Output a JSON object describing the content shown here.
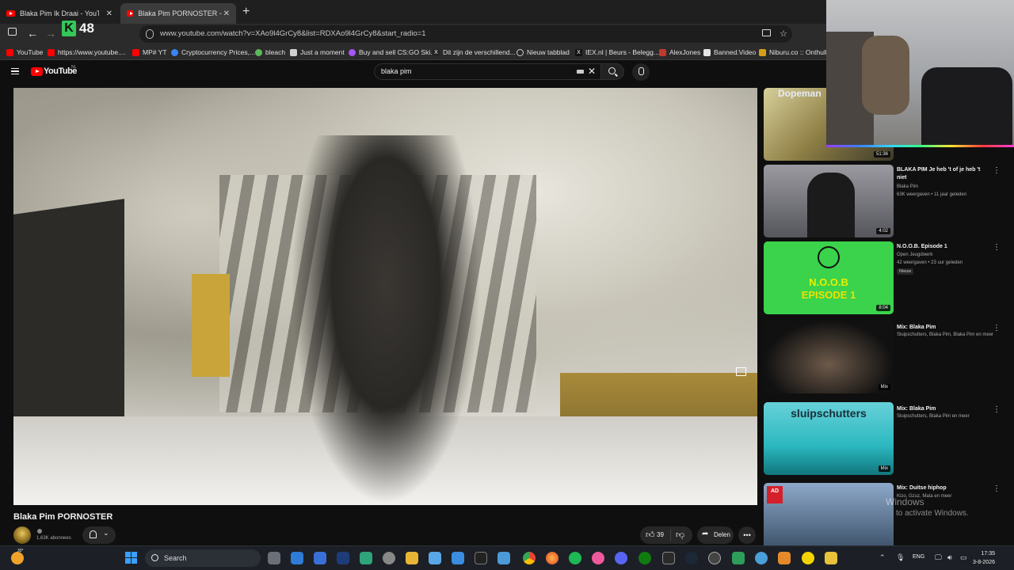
{
  "browser": {
    "tabs": [
      {
        "title": "Blaka Pim Ik Draai - YouTube",
        "active": false
      },
      {
        "title": "Blaka Pim PORNOSTER - YouTube",
        "active": true
      }
    ],
    "new_tab_glyph": "+",
    "close_glyph": "✕",
    "url": "www.youtube.com/watch?v=XAo9l4GrCy8&list=RDXAo9l4GrCy8&start_radio=1",
    "counter_logo": "K",
    "counter_value": "48",
    "bookmarks": [
      {
        "label": "YouTube",
        "color": "#ff0000"
      },
      {
        "label": "https://www.youtube....",
        "color": "#ff0000"
      },
      {
        "label": "MP# YT",
        "color": "#ff0000"
      },
      {
        "label": "Cryptocurrency Prices,...",
        "color": "#3b82f6"
      },
      {
        "label": "bleach",
        "color": "#5cb85c"
      },
      {
        "label": "Just a moment",
        "color": "#d0d0d0"
      },
      {
        "label": "Buy and sell CS:GO Ski...",
        "color": "#a855f7"
      },
      {
        "label": "Dit zijn de verschillend...",
        "color": "#222222"
      },
      {
        "label": "Nieuw tabblad",
        "color": "#9ca3af"
      },
      {
        "label": "IEX.nl | Beurs - Belegg...",
        "color": "#111111"
      },
      {
        "label": "AlexJones",
        "color": "#c0392b"
      },
      {
        "label": "Banned.Video",
        "color": "#e5e5e5"
      },
      {
        "label": "Niburu.co :: Onthulle",
        "color": "#d4a017"
      }
    ]
  },
  "youtube": {
    "logo_text": "YouTube",
    "country": "NL",
    "search_value": "blaka pim",
    "video": {
      "title": "Blaka Pim PORNOSTER",
      "subscribers": "1,63K abonnees",
      "likes": "39",
      "share_label": "Delen",
      "more_glyph": "•••"
    },
    "recommendations": [
      {
        "thumb_text": "Dopeman",
        "duration": "51:36",
        "title": "",
        "channel": "",
        "meta": ""
      },
      {
        "duration": "4:02",
        "title": "BLAKA PIM Je heb 't of je heb 't niet",
        "channel": "Blaka Pim",
        "meta": "63K weergaven • 11 jaar geleden"
      },
      {
        "thumb_text": "N.O.O.B",
        "thumb_text2": "EPISODE 1",
        "duration": "8:04",
        "title": "N.O.O.B. Episode 1",
        "channel": "Open Jeugdwerk",
        "meta": "42 weergaven • 23 uur geleden",
        "badge": "Nieuw"
      },
      {
        "duration": "Mix",
        "title": "Mix: Blaka Pim",
        "channel": "Sluipschutters, Blaka Pim, Blaka Pim en meer"
      },
      {
        "thumb_text": "sluipschutters",
        "duration": "Mix",
        "title": "Mix: Blaka Pim",
        "channel": "Sluipschutters, Blaka Pim en meer"
      },
      {
        "thumb_text": "AD",
        "title": "Mix: Duitse hiphop",
        "channel": "Kizo, Gzuz, Mata en meer"
      }
    ]
  },
  "windows": {
    "activate_title": "Windows",
    "activate_sub": "to activate Windows.",
    "weather_temp": "30°",
    "search_label": "Search",
    "language": "ENG",
    "time": "17:35",
    "date": "3-8-2026"
  }
}
